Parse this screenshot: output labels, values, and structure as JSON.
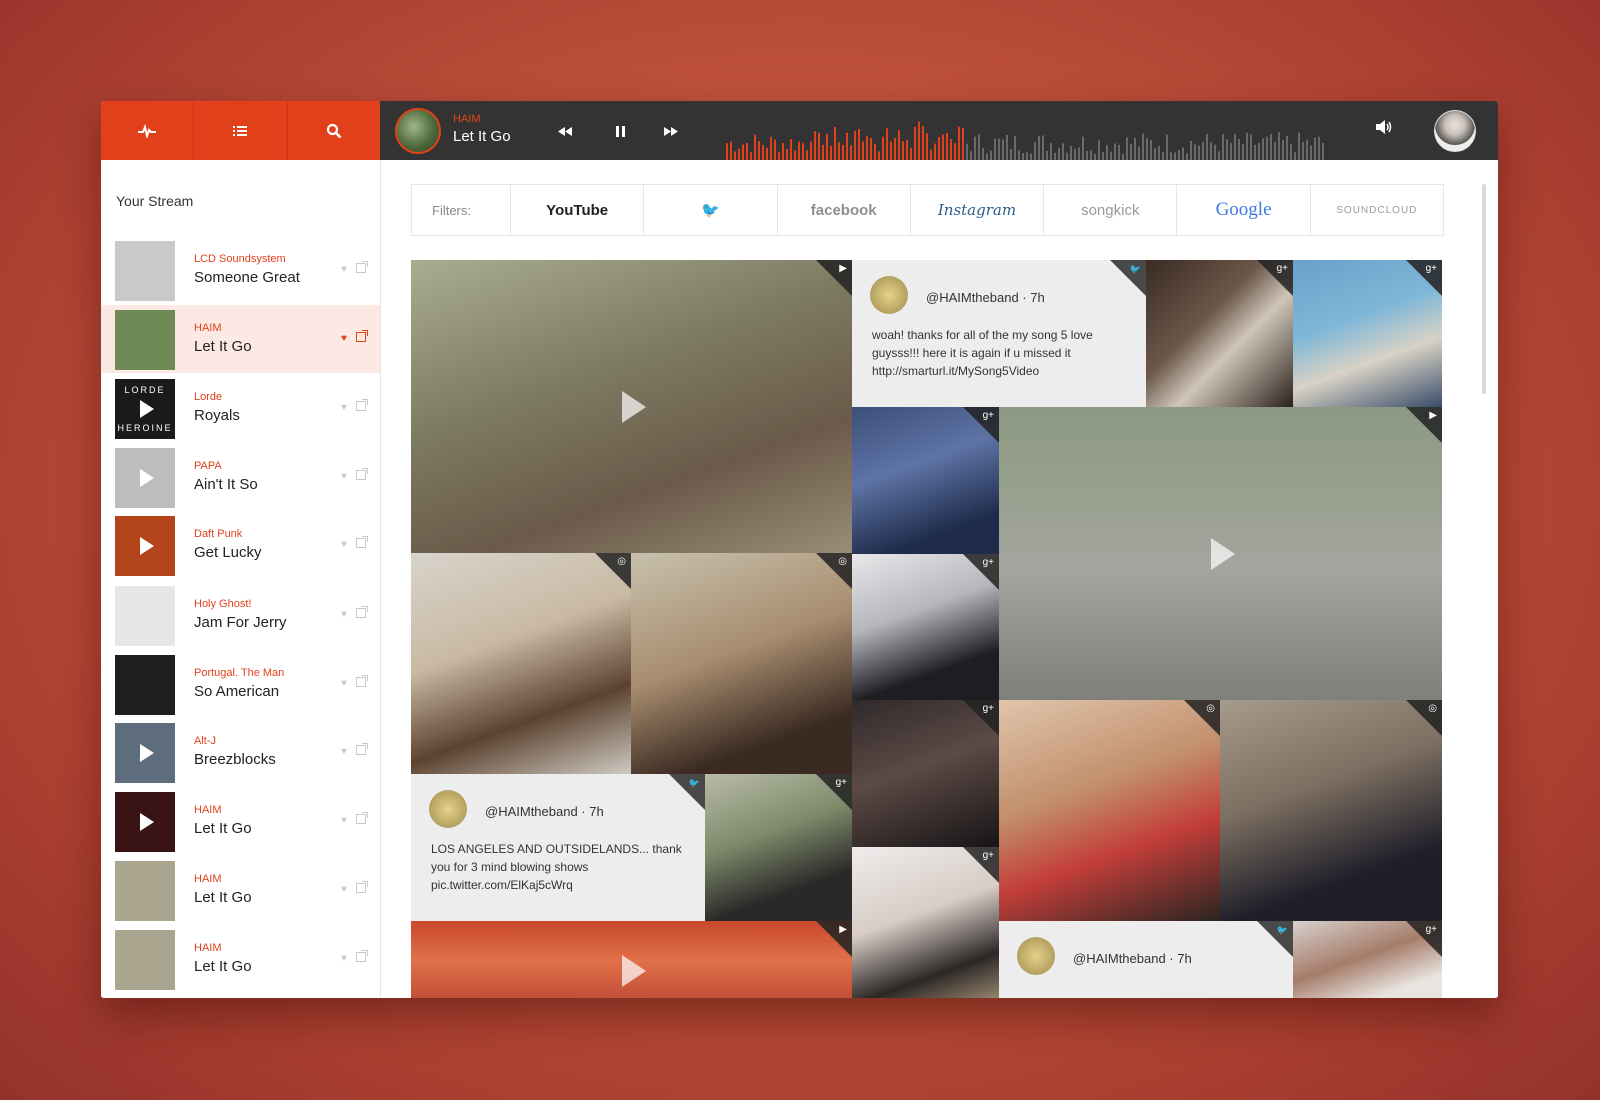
{
  "player": {
    "artist": "HAIM",
    "track": "Let It Go"
  },
  "sidebar": {
    "heading": "Your Stream",
    "items": [
      {
        "artist": "LCD Soundsystem",
        "track": "Someone Great",
        "thumb": "#c9c9c9",
        "play": false,
        "active": false
      },
      {
        "artist": "HAIM",
        "track": "Let It Go",
        "thumb": "#6e8a55",
        "play": false,
        "active": true
      },
      {
        "artist": "Lorde",
        "track": "Royals",
        "thumb": "#1a1a1a",
        "play": true,
        "active": false,
        "thumb_text_top": "LORDE",
        "thumb_text_bottom": "HEROINE"
      },
      {
        "artist": "PAPA",
        "track": "Ain't It So",
        "thumb": "#bdbdbd",
        "play": true,
        "active": false
      },
      {
        "artist": "Daft Punk",
        "track": "Get Lucky",
        "thumb": "#b4441a",
        "play": true,
        "active": false
      },
      {
        "artist": "Holy Ghost!",
        "track": "Jam For Jerry",
        "thumb": "#e6e6e6",
        "play": false,
        "active": false
      },
      {
        "artist": "Portugal. The Man",
        "track": "So American",
        "thumb": "#1e1e1e",
        "play": false,
        "active": false
      },
      {
        "artist": "Alt-J",
        "track": "Breezblocks",
        "thumb": "#5d6d7d",
        "play": true,
        "active": false
      },
      {
        "artist": "HAIM",
        "track": "Let It Go",
        "thumb": "#3a1414",
        "play": true,
        "active": false
      },
      {
        "artist": "HAIM",
        "track": "Let It Go",
        "thumb": "#a9a58e",
        "play": false,
        "active": false
      },
      {
        "artist": "HAIM",
        "track": "Let It Go",
        "thumb": "#a9a58e",
        "play": false,
        "active": false
      }
    ]
  },
  "filters": {
    "label": "Filters:",
    "sources": [
      {
        "name": "YouTube",
        "text": "YouTube",
        "color": "#222"
      },
      {
        "name": "twitter",
        "text": "🐦",
        "color": "#2fa8e6"
      },
      {
        "name": "facebook",
        "text": "facebook",
        "color": "#8f8f8f"
      },
      {
        "name": "instagram",
        "text": "Instagram",
        "color": "#2d5b8f"
      },
      {
        "name": "songkick",
        "text": "songkick",
        "color": "#9a9a9a"
      },
      {
        "name": "google",
        "text": "Google",
        "color": "#3c79e6"
      },
      {
        "name": "soundcloud",
        "text": "SOUNDCLOUD",
        "color": "#9a9a9a"
      }
    ]
  },
  "stream": {
    "tiles": [
      {
        "kind": "video",
        "icon": "▶",
        "bg": "linear-gradient(160deg,#a9ad8f 0%,#7d7a62 40%,#6b5a49 70%,#9a8c78 100%)"
      },
      {
        "kind": "tweet",
        "icon": "twitter-icon",
        "handle": "@HAIMtheband · 7h",
        "text": "woah! thanks for all of the my song 5 love guysss!!! here it is again if u missed it http://smarturl.it/MySong5Video"
      },
      {
        "kind": "photo",
        "icon": "g+",
        "bg": "linear-gradient(135deg,#3a2a22,#6b584a 40%,#cfc6b8 60%,#2b211c)"
      },
      {
        "kind": "photo",
        "icon": "g+",
        "bg": "linear-gradient(160deg,#6aa0c9,#7fb7d8 40%,#d8d2c5 65%,#3a4d6a)"
      },
      {
        "kind": "photo",
        "icon": "g+",
        "bg": "linear-gradient(160deg,#3b4f7a,#5e74a6 40%,#1e2b4a 80%)"
      },
      {
        "kind": "video",
        "icon": "▶",
        "bg": "linear-gradient(180deg,#8d9a83 0%,#98a08e 30%,#a5a5a0 55%,#7f7f7c 100%)"
      },
      {
        "kind": "photo",
        "icon": "◎",
        "bg": "linear-gradient(160deg,#d8d4cc,#c9b9a3 40%,#5c4330 70%,#cfcac2)"
      },
      {
        "kind": "photo",
        "icon": "◎",
        "bg": "linear-gradient(160deg,#c7c1ad,#a88d6f 45%,#3a2a22 80%)"
      },
      {
        "kind": "photo",
        "icon": "g+",
        "bg": "linear-gradient(160deg,#e8e8ea,#b5b7bd 40%,#1d1d22 75%)"
      },
      {
        "kind": "photo",
        "icon": "g+",
        "bg": "linear-gradient(160deg,#2f2a2b,#5c4a45 45%,#171416)"
      },
      {
        "kind": "photo",
        "icon": "◎",
        "bg": "linear-gradient(160deg,#e0c5ac,#c28f6c 40%,#c33e3a 65%,#2b2521)"
      },
      {
        "kind": "photo",
        "icon": "◎",
        "bg": "linear-gradient(160deg,#a79b8b,#7c6e60 40%,#1f1f2a 75%)"
      },
      {
        "kind": "tweet",
        "icon": "twitter-icon",
        "handle": "@HAIMtheband · 7h",
        "text": "LOS ANGELES AND OUTSIDELANDS... thank you for 3 mind blowing shows pic.twitter.com/ElKaj5cWrq"
      },
      {
        "kind": "photo",
        "icon": "g+",
        "bg": "linear-gradient(160deg,#b9bca8,#7e8b6b 40%,#2a2828 75%)"
      },
      {
        "kind": "photo",
        "icon": "g+",
        "bg": "linear-gradient(160deg,#efecec,#d7cdc5 40%,#2c2726 70%,#c7b08f)"
      },
      {
        "kind": "video",
        "icon": "▶",
        "bg": "linear-gradient(180deg,#c9482e,#e0714a 40%,#b23b2a)"
      },
      {
        "kind": "tweet",
        "icon": "twitter-icon",
        "handle": "@HAIMtheband · 7h",
        "text": ""
      },
      {
        "kind": "photo",
        "icon": "g+",
        "bg": "linear-gradient(160deg,#d7d1cd,#a67c6a 40%,#e8e4e0 70%)"
      }
    ]
  },
  "colors": {
    "accent": "#e2401b",
    "player_bg": "#333333"
  }
}
